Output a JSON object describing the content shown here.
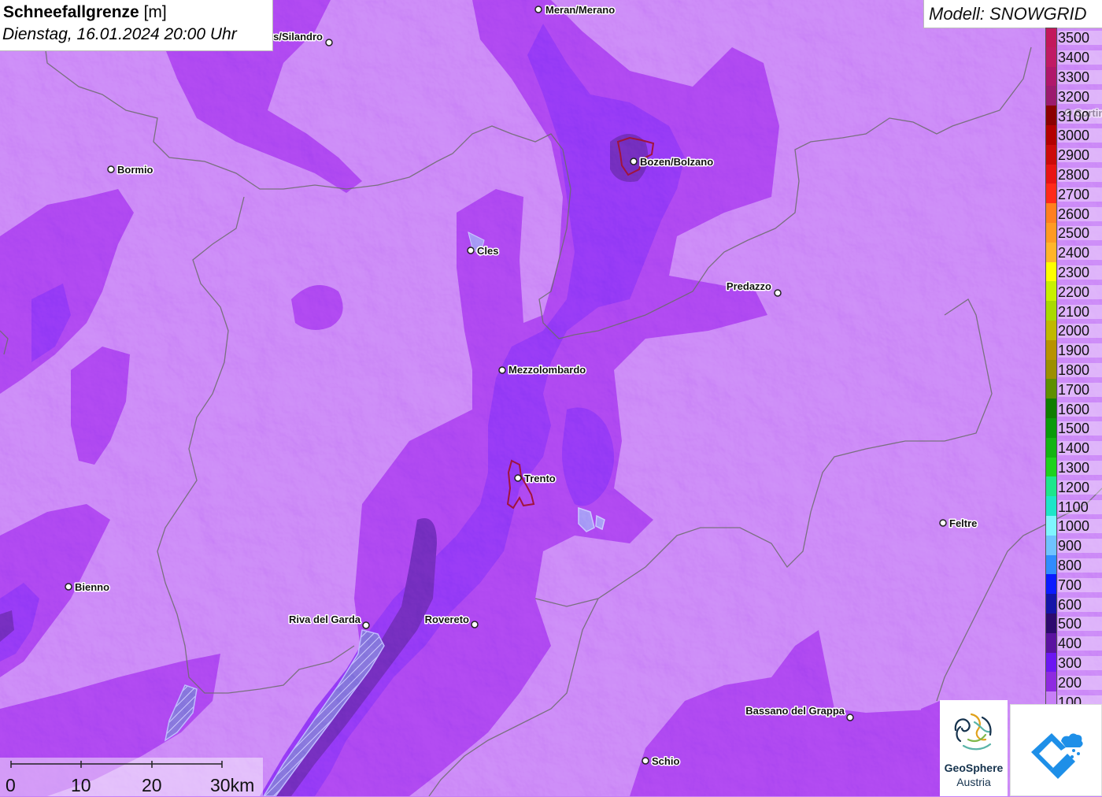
{
  "title": {
    "main": "Schneefallgrenze",
    "unit": "[m]",
    "datetime": "Dienstag, 16.01.2024 20:00 Uhr"
  },
  "model": {
    "label": "Modell: SNOWGRID"
  },
  "legend": {
    "items": [
      {
        "label": "3500",
        "color": "#c2185b"
      },
      {
        "label": "3400",
        "color": "#c01a64"
      },
      {
        "label": "3300",
        "color": "#b0176a"
      },
      {
        "label": "3200",
        "color": "#9c1a6e"
      },
      {
        "label": "3100",
        "color": "#8b0000"
      },
      {
        "label": "3000",
        "color": "#b30000"
      },
      {
        "label": "2900",
        "color": "#cc0a0a"
      },
      {
        "label": "2800",
        "color": "#e81414"
      },
      {
        "label": "2700",
        "color": "#ff2a1a"
      },
      {
        "label": "2600",
        "color": "#ff7f1f"
      },
      {
        "label": "2500",
        "color": "#ff9a22"
      },
      {
        "label": "2400",
        "color": "#ffb52a"
      },
      {
        "label": "2300",
        "color": "#ffff00"
      },
      {
        "label": "2200",
        "color": "#c8f000"
      },
      {
        "label": "2100",
        "color": "#a9d900"
      },
      {
        "label": "2000",
        "color": "#c0b800"
      },
      {
        "label": "1900",
        "color": "#b89200"
      },
      {
        "label": "1800",
        "color": "#9c8f00"
      },
      {
        "label": "1700",
        "color": "#5e8f00"
      },
      {
        "label": "1600",
        "color": "#0f7d00"
      },
      {
        "label": "1500",
        "color": "#0a9a0a"
      },
      {
        "label": "1400",
        "color": "#14b414"
      },
      {
        "label": "1300",
        "color": "#1ed21e"
      },
      {
        "label": "1200",
        "color": "#1ee68c"
      },
      {
        "label": "1100",
        "color": "#1ee6c8"
      },
      {
        "label": "1000",
        "color": "#7ff5ff"
      },
      {
        "label": "900",
        "color": "#6fc3ff"
      },
      {
        "label": "800",
        "color": "#2f8cff"
      },
      {
        "label": "700",
        "color": "#0b1bff"
      },
      {
        "label": "600",
        "color": "#1414a8"
      },
      {
        "label": "500",
        "color": "#2d0a6e"
      },
      {
        "label": "400",
        "color": "#5a12a0"
      },
      {
        "label": "300",
        "color": "#6c17f2"
      },
      {
        "label": "200",
        "color": "#8e2ae0"
      },
      {
        "label": "100",
        "color": "#c77ef7"
      }
    ]
  },
  "cities": [
    {
      "name": "Meran/Merano"
    },
    {
      "name": "Schlanders/Silandro"
    },
    {
      "name": "Bormio"
    },
    {
      "name": "Bozen/Bolzano"
    },
    {
      "name": "Cles"
    },
    {
      "name": "Predazzo"
    },
    {
      "name": "Mezzolombardo"
    },
    {
      "name": "Trento"
    },
    {
      "name": "Feltre"
    },
    {
      "name": "Bienno"
    },
    {
      "name": "Riva del Garda"
    },
    {
      "name": "Rovereto"
    },
    {
      "name": "Bassano del Grappa"
    },
    {
      "name": "Schio"
    },
    {
      "name": "Cortina"
    }
  ],
  "scale_bar": {
    "labels": [
      "0",
      "10",
      "20",
      "30km"
    ]
  },
  "logo": {
    "line1": "GeoSphere",
    "line2": "Austria"
  },
  "colors": {
    "zone_100": "#c77ef7",
    "zone_200": "#a642f0",
    "zone_300": "#8a35f5",
    "zone_400": "#6a2ab8",
    "lake": "#9d8ff5",
    "border": "#6b6b6b"
  }
}
